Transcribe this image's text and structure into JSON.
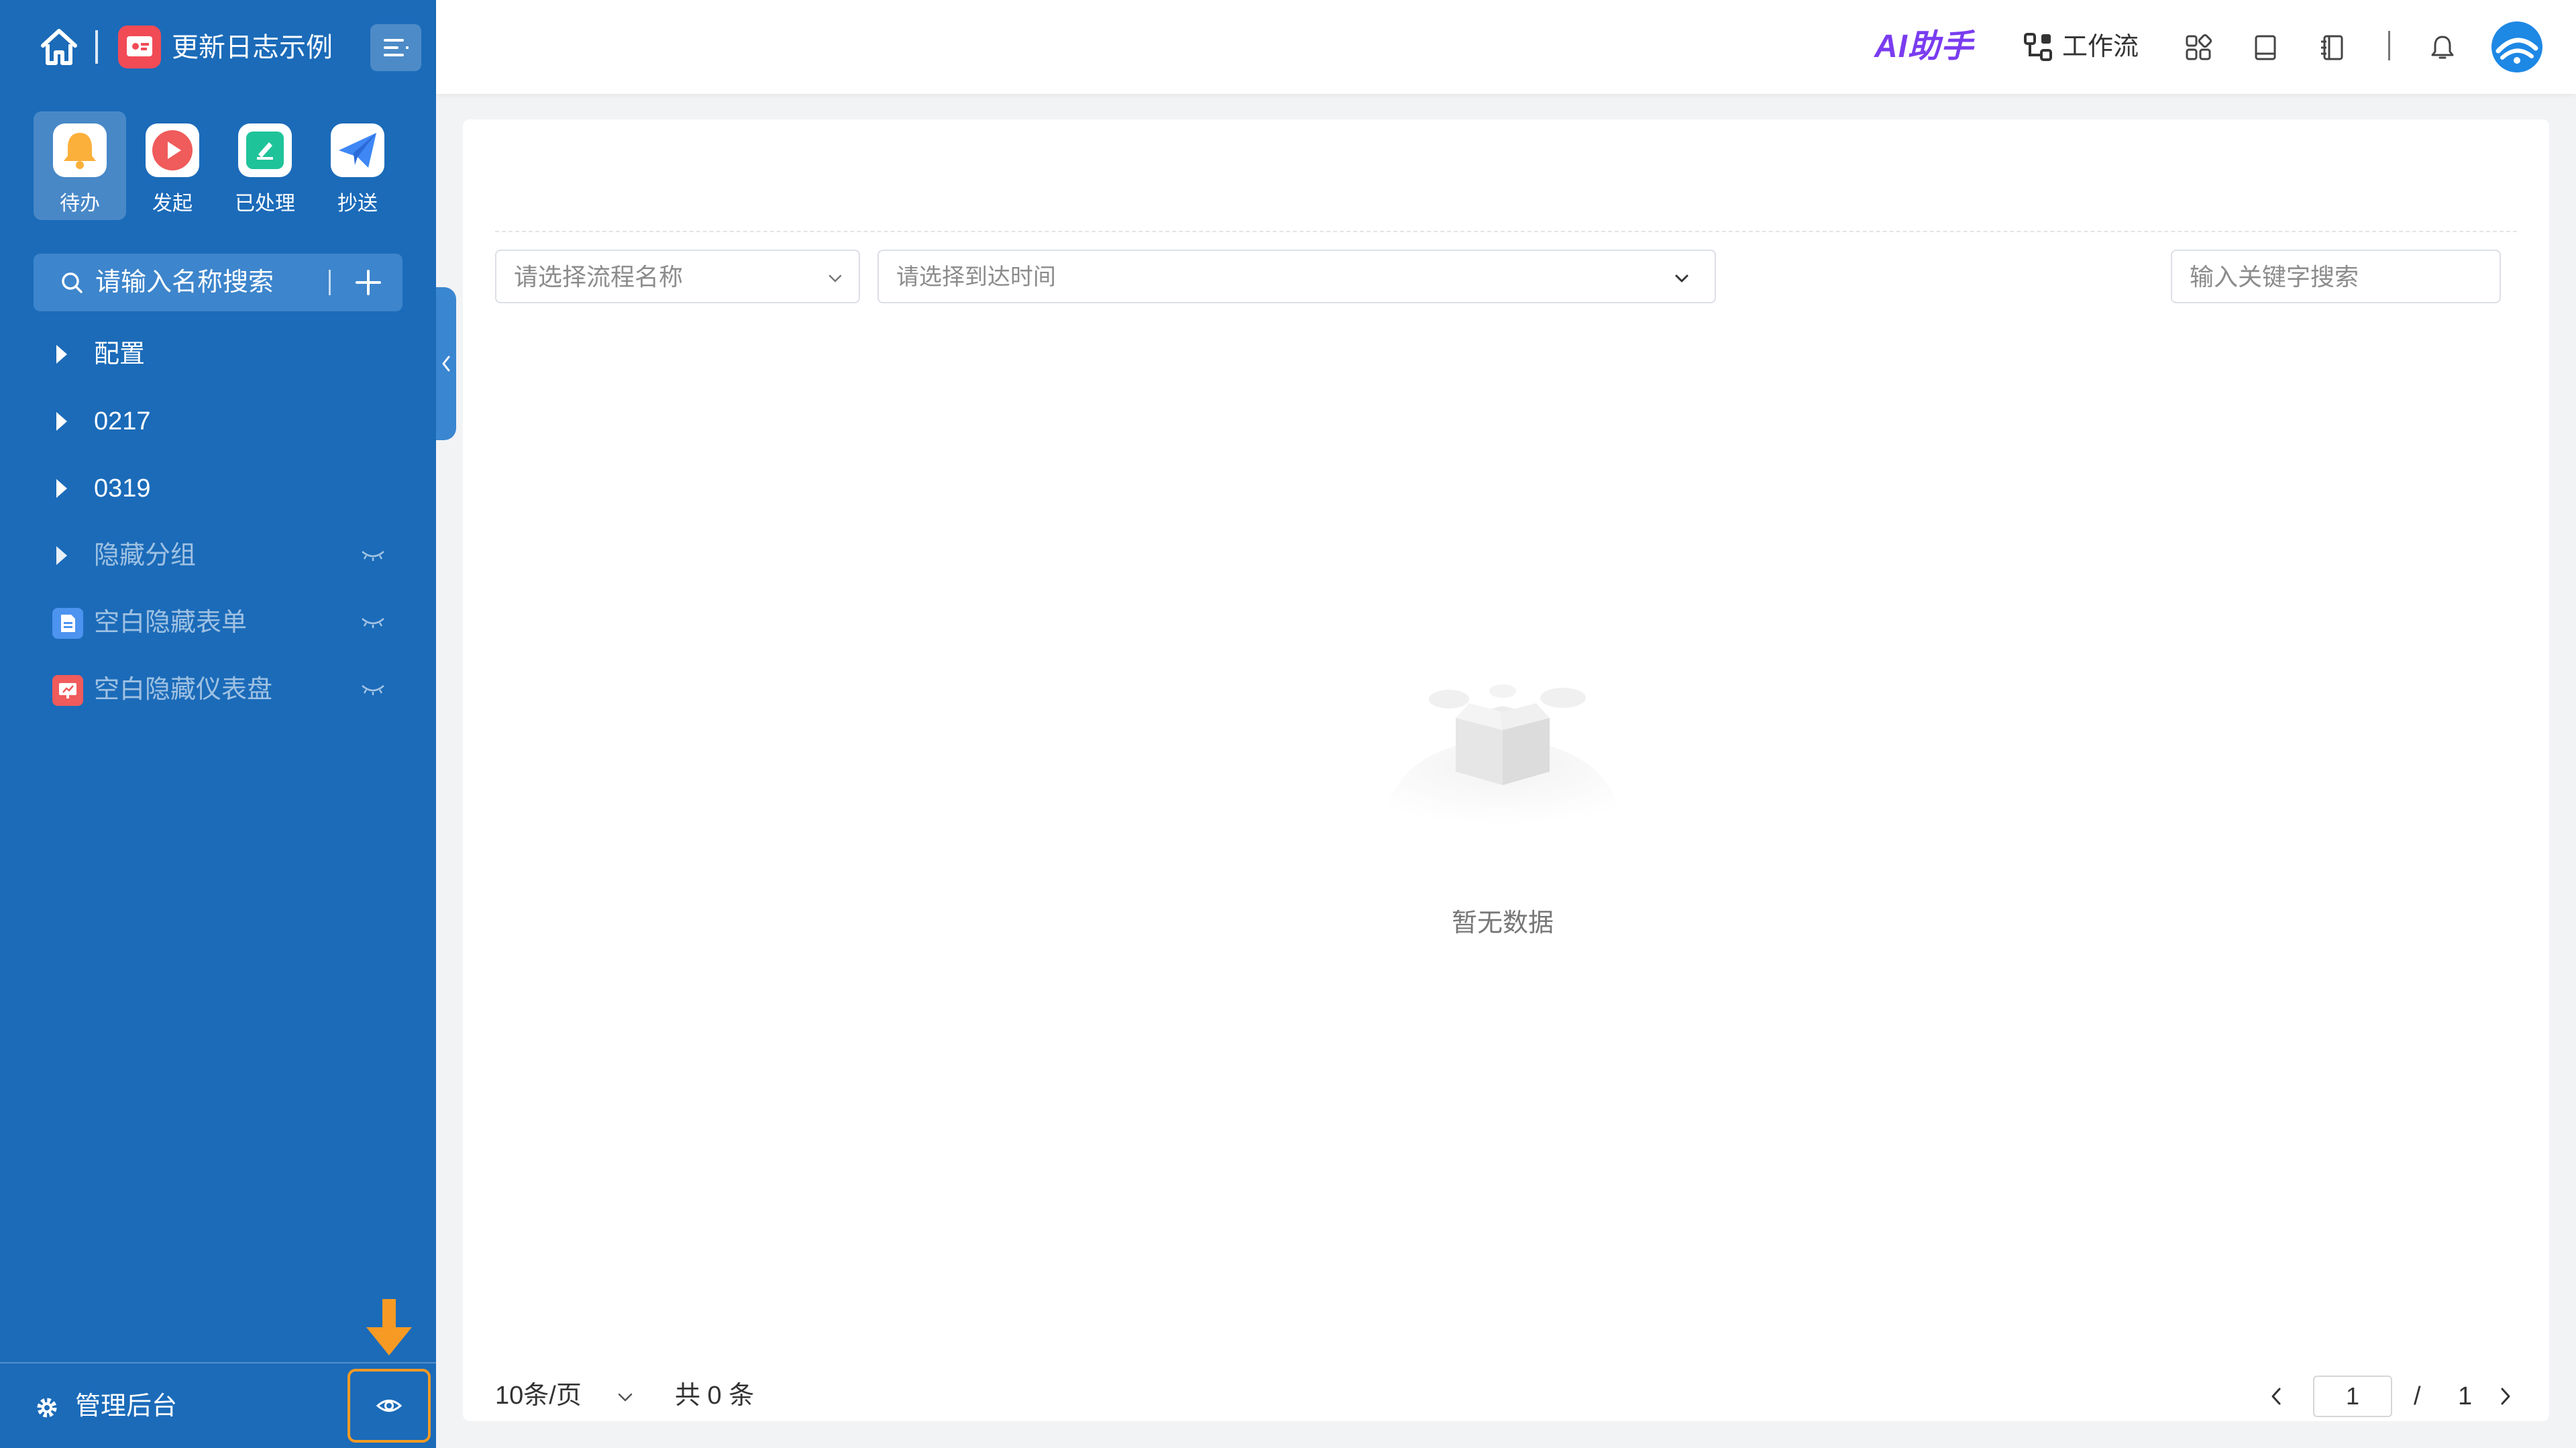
{
  "app": {
    "title": "更新日志示例"
  },
  "quick_actions": [
    {
      "label": "待办",
      "icon": "bell-icon",
      "color": "#fbb03b"
    },
    {
      "label": "发起",
      "icon": "play-icon",
      "color": "#f05b5b"
    },
    {
      "label": "已处理",
      "icon": "edit-check-icon",
      "color": "#1fc39a"
    },
    {
      "label": "抄送",
      "icon": "paper-plane-icon",
      "color": "#3e87f5"
    }
  ],
  "sidebar": {
    "search_placeholder": "请输入名称搜索",
    "items": [
      {
        "label": "配置"
      },
      {
        "label": "0217"
      },
      {
        "label": "0319"
      },
      {
        "label": "隐藏分组"
      },
      {
        "label": "空白隐藏表单"
      },
      {
        "label": "空白隐藏仪表盘"
      }
    ],
    "footer_label": "管理后台"
  },
  "topbar": {
    "ai_label": "AI助手",
    "workflow_label": "工作流",
    "icons": [
      "apps-grid-icon",
      "book-icon",
      "notebook-icon",
      "bell-icon",
      "avatar"
    ]
  },
  "filters": {
    "process_placeholder": "请选择流程名称",
    "time_placeholder": "请选择到达时间",
    "keyword_placeholder": "输入关键字搜索"
  },
  "empty_text": "暂无数据",
  "pagination": {
    "page_size": "10条/页",
    "total": "共 0 条",
    "current_page": "1",
    "slash": "/",
    "total_pages": "1"
  },
  "colors": {
    "sidebar_bg": "#1b6bb9",
    "highlight_orange": "#f79a23",
    "ai_purple": "#7a3cf0"
  }
}
